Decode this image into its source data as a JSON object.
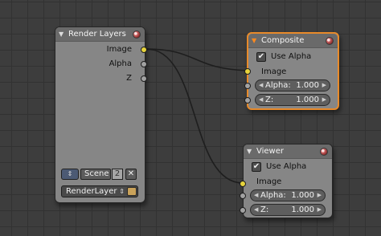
{
  "render_layers_node": {
    "title": "Render Layers",
    "outputs": {
      "image": "Image",
      "alpha": "Alpha",
      "z": "Z"
    },
    "scene": {
      "name": "Scene",
      "users": "2",
      "clear_glyph": "✕"
    },
    "layer": "RenderLayer"
  },
  "composite_node": {
    "title": "Composite",
    "use_alpha_label": "Use Alpha",
    "use_alpha_checked": true,
    "inputs": {
      "image": "Image",
      "alpha_label": "Alpha:",
      "alpha_value": "1.000",
      "z_label": "Z:",
      "z_value": "1.000"
    }
  },
  "viewer_node": {
    "title": "Viewer",
    "use_alpha_label": "Use Alpha",
    "use_alpha_checked": true,
    "inputs": {
      "image": "Image",
      "alpha_label": "Alpha:",
      "alpha_value": "1.000",
      "z_label": "Z:",
      "z_value": "1.000"
    }
  },
  "glyphs": {
    "collapse": "▼",
    "check": "✔",
    "arrow_left": "◀",
    "arrow_right": "▶",
    "updown": "⇕"
  },
  "icons": {
    "node_preview": "node-preview-icon",
    "scene_browse": "scene-browse-icon",
    "render_layer": "render-icon"
  },
  "colors": {
    "image_socket": "#e6d33c",
    "value_socket": "#a2a2a2",
    "active_border": "#e88a2a",
    "link": "#1e1e1e"
  }
}
